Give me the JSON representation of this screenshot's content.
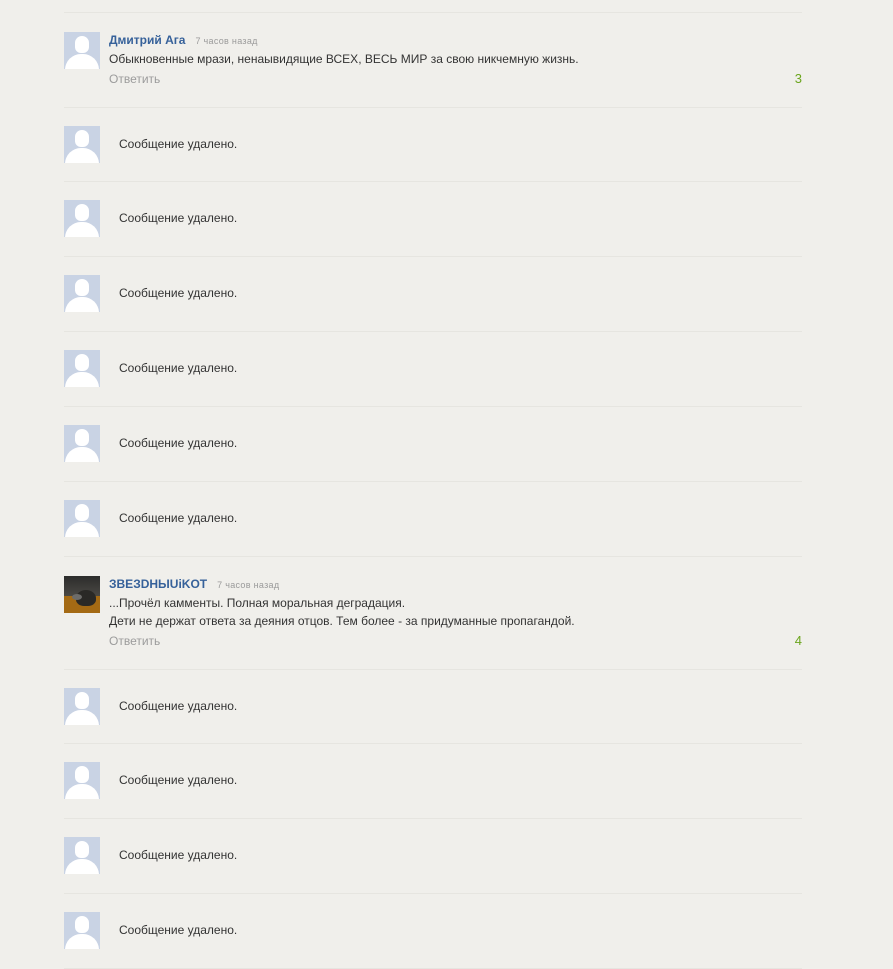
{
  "comments": [
    {
      "type": "full",
      "author": "Дмитрий Ага",
      "time": "7 часов назад",
      "lines": [
        "Обыкновенные мрази, ненаывидящие ВСЕХ, ВЕСЬ МИР за свою никчемную жизнь."
      ],
      "reply_label": "Ответить",
      "rating": "3"
    },
    {
      "type": "deleted",
      "text": "Сообщение удалено."
    },
    {
      "type": "deleted",
      "text": "Сообщение удалено."
    },
    {
      "type": "deleted",
      "text": "Сообщение удалено."
    },
    {
      "type": "deleted",
      "text": "Сообщение удалено."
    },
    {
      "type": "deleted",
      "text": "Сообщение удалено."
    },
    {
      "type": "deleted",
      "text": "Сообщение удалено."
    },
    {
      "type": "full",
      "author": "ЗВЕЗDHЫUiKOT",
      "time": "7 часов назад",
      "lines": [
        "...Прочёл камменты. Полная моральная деградация.",
        "Дети не держат ответа за деяния отцов. Тем более - за придуманные пропагандой."
      ],
      "reply_label": "Ответить",
      "rating": "4"
    },
    {
      "type": "deleted",
      "text": "Сообщение удалено."
    },
    {
      "type": "deleted",
      "text": "Сообщение удалено."
    },
    {
      "type": "deleted",
      "text": "Сообщение удалено."
    },
    {
      "type": "deleted",
      "text": "Сообщение удалено."
    }
  ],
  "colors": {
    "background": "#f0efeb",
    "author": "#36619a",
    "rating": "#6ba51d",
    "reply": "#9b9b9b",
    "avatar_placeholder": "#c9d3e4"
  },
  "icons": {
    "default_avatar": "user-silhouette-icon"
  }
}
